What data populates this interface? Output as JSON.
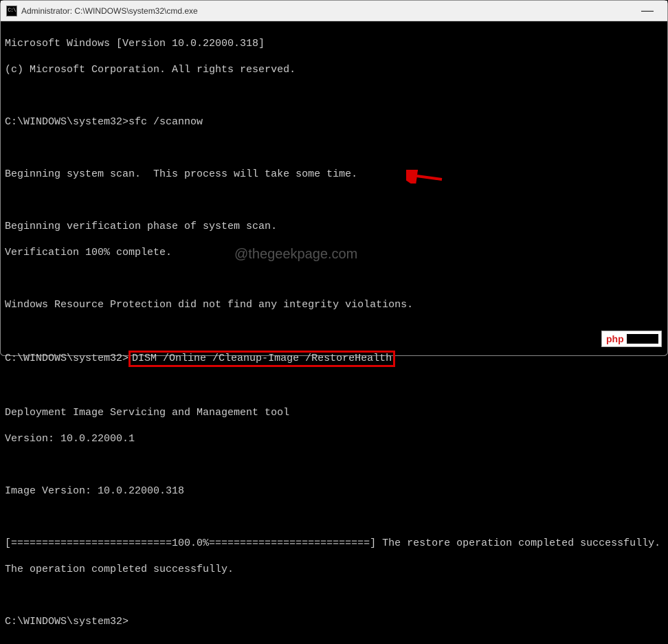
{
  "window": {
    "title": "Administrator: C:\\WINDOWS\\system32\\cmd.exe",
    "icon_label": "C:\\"
  },
  "terminal": {
    "header1": "Microsoft Windows [Version 10.0.22000.318]",
    "header2": "(c) Microsoft Corporation. All rights reserved.",
    "prompt1": "C:\\WINDOWS\\system32>",
    "cmd1": "sfc /scannow",
    "scan1": "Beginning system scan.  This process will take some time.",
    "scan2": "Beginning verification phase of system scan.",
    "scan3": "Verification 100% complete.",
    "result1": "Windows Resource Protection did not find any integrity violations.",
    "prompt2": "C:\\WINDOWS\\system32>",
    "cmd2": "DISM /Online /Cleanup-Image /RestoreHealth",
    "dism1": "Deployment Image Servicing and Management tool",
    "dism2": "Version: 10.0.22000.1",
    "dism3": "Image Version: 10.0.22000.318",
    "progress": "[==========================100.0%==========================] The restore operation completed successfully.",
    "done": "The operation completed successfully.",
    "prompt3": "C:\\WINDOWS\\system32>"
  },
  "watermark": "@thegeekpage.com",
  "badge": {
    "text": "php"
  }
}
